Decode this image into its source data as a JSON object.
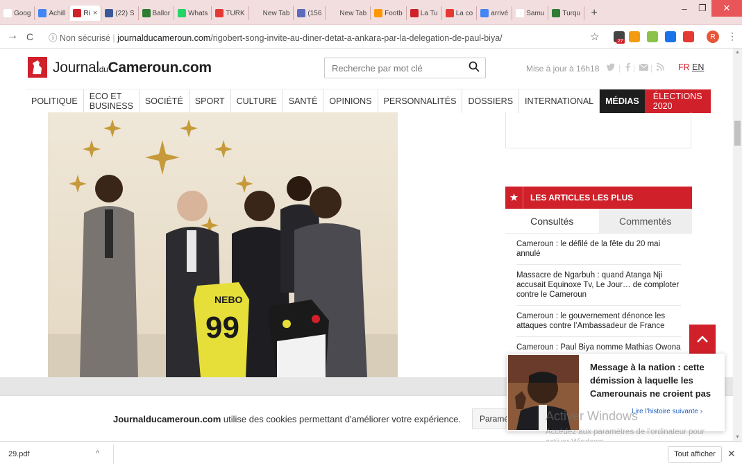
{
  "browser": {
    "tabs": [
      {
        "label": "Goog",
        "color": "#ffffff"
      },
      {
        "label": "Achill",
        "color": "#4285f4"
      },
      {
        "label": "Ri",
        "color": "#d0202a",
        "active": true
      },
      {
        "label": "(22) S",
        "color": "#3b5998"
      },
      {
        "label": "Ballor",
        "color": "#2e7d32"
      },
      {
        "label": "Whats",
        "color": "#25d366"
      },
      {
        "label": "TURK",
        "color": "#e53935"
      },
      {
        "label": "New Tab",
        "color": "#f2dede"
      },
      {
        "label": "(156",
        "color": "#5c6bc0"
      },
      {
        "label": "New Tab",
        "color": "#f2dede"
      },
      {
        "label": "Footb",
        "color": "#ff9800"
      },
      {
        "label": "La Tu",
        "color": "#d0202a"
      },
      {
        "label": "La co",
        "color": "#e53935"
      },
      {
        "label": "arrivé",
        "color": "#4285f4"
      },
      {
        "label": "Samu",
        "color": "#ffffff"
      },
      {
        "label": "Turqu",
        "color": "#2e7d32"
      }
    ],
    "new_tab_glyph": "+",
    "tab_close_glyph": "×",
    "nav_forward_glyph": "→",
    "nav_reload_glyph": "C",
    "security_label": "ⓘ Non sécurisé",
    "url_domain": "journalducameroun.com",
    "url_path": "/rigobert-song-invite-au-diner-detat-a-ankara-par-la-delegation-de-paul-biya/",
    "star_glyph": "☆",
    "ext_badge": "27",
    "profile_initial": "R",
    "menu_glyph": "⋮",
    "win_min": "–",
    "win_max": "❐",
    "win_close": "✕"
  },
  "site": {
    "logo_main_1": "Journal",
    "logo_du": "du",
    "logo_main_2": "Cameroun.com",
    "search_placeholder": "Recherche par mot clé",
    "search_glyph": "🔍",
    "update_text": "Mise à jour à 16h18",
    "lang_fr": "FR",
    "lang_en": "EN",
    "brand_red": "#d0202a"
  },
  "nav": {
    "items": [
      "POLITIQUE",
      "ECO ET BUSINESS",
      "SOCIÉTÉ",
      "SPORT",
      "CULTURE",
      "SANTÉ",
      "OPINIONS",
      "PERSONNALITÉS",
      "DOSSIERS",
      "INTERNATIONAL"
    ],
    "medias": "MÉDIAS",
    "elections": "ÉLECTIONS 2020"
  },
  "popular": {
    "star": "★",
    "title": "LES ARTICLES LES PLUS",
    "tab_consultes": "Consultés",
    "tab_commentes": "Commentés",
    "items": [
      "Cameroun : le défilé de la fête du 20 mai annulé",
      "Massacre de Ngarbuh : quand Atanga Nji accusait Equinoxe Tv, Le Jour… de comploter contre le Cameroun",
      "Cameroun : le gouvernement dénonce les attaques contre l’Ambassadeur de France",
      "Cameroun : Paul Biya nomme Mathias Owona"
    ]
  },
  "cookie": {
    "brand": "Journalducameroun.com",
    "text": " utilise des cookies permettant d'améliorer votre expérience.",
    "button": "Paramé"
  },
  "next_story": {
    "title": "Message à la nation : cette démission à laquelle les Camerounais ne croient pas",
    "link": "Lire l'histoire suivante ›"
  },
  "watermark": {
    "line1": "Activer Windows",
    "line2": "Accédez aux paramètres de l'ordinateur pour activer Windows."
  },
  "downloads": {
    "file": "29.pdf",
    "chevron": "^",
    "show_all": "Tout afficher",
    "close": "✕"
  }
}
